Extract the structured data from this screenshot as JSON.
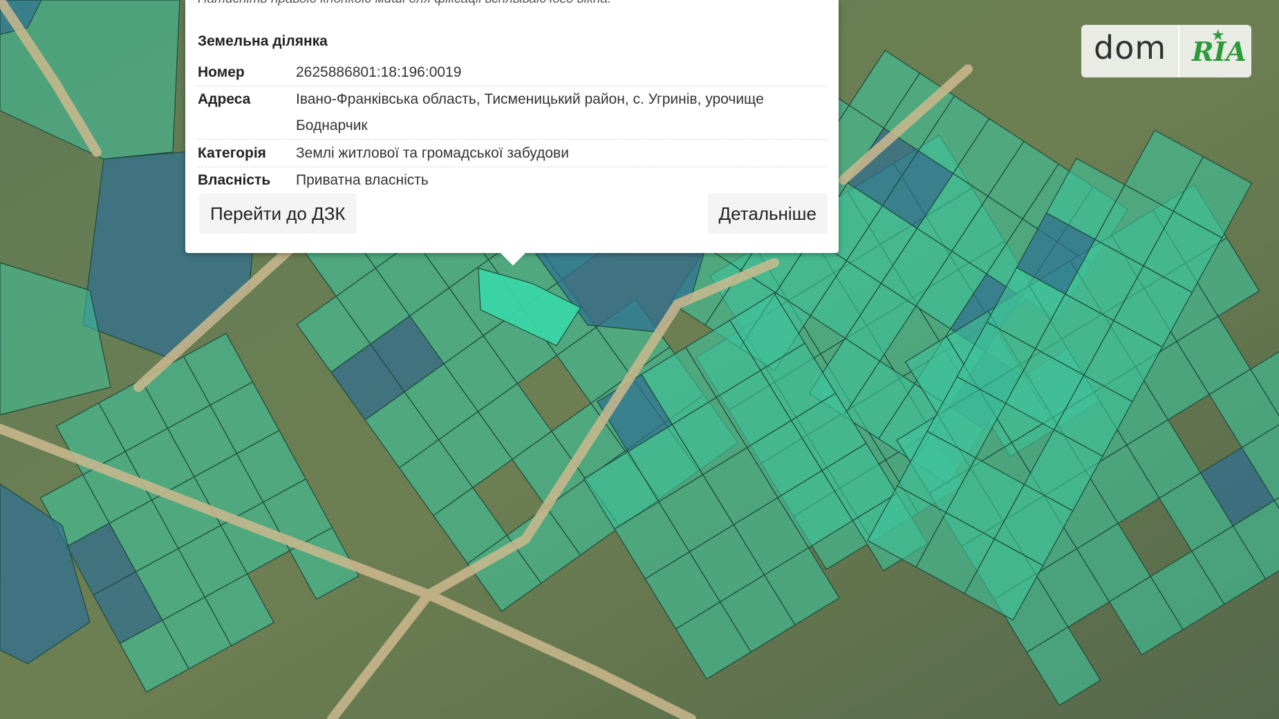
{
  "popup": {
    "hint": "Натисніть правою кнопкою миші для фіксації всплываючого вікна.",
    "title": "Земельна ділянка",
    "fields": [
      {
        "label": "Номер",
        "value": "2625886801:18:196:0019"
      },
      {
        "label": "Адреса",
        "value": "Івано-Франківська область, Тисменицький район, с. Угринів, урочище Боднарчик"
      },
      {
        "label": "Категорія",
        "value": "Землі житлової та громадської забудови"
      },
      {
        "label": "Власність",
        "value": "Приватна власність"
      }
    ],
    "buttons": {
      "dzk": "Перейти до ДЗК",
      "details": "Детальніше"
    }
  },
  "logo": {
    "left": "dom",
    "right": "RIA"
  },
  "colors": {
    "parcel_green": "#3fc29a",
    "parcel_blue": "#2f6f93",
    "selected": "#3ad7a7",
    "road": "#c9b48a"
  }
}
